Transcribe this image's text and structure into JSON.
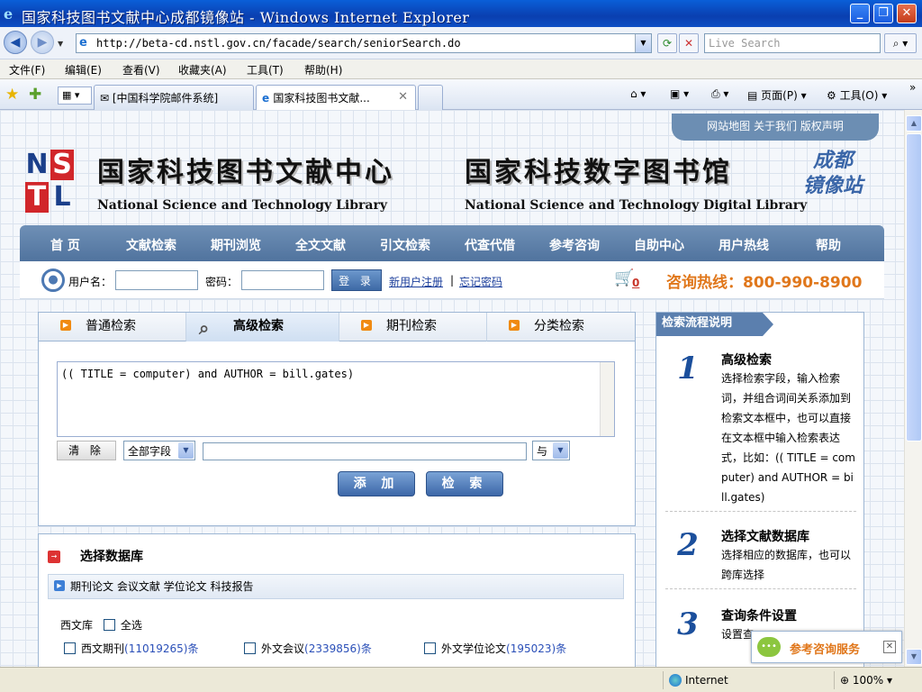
{
  "window": {
    "title": "国家科技图书文献中心成都镜像站 - Windows Internet Explorer",
    "min": "_",
    "max": "❐",
    "close": "✕"
  },
  "address": {
    "url": "http://beta-cd.nstl.gov.cn/facade/search/seniorSearch.do",
    "search_placeholder": "Live Search"
  },
  "menu": [
    "文件(F)",
    "编辑(E)",
    "查看(V)",
    "收藏夹(A)",
    "工具(T)",
    "帮助(H)"
  ],
  "tabs": {
    "items": [
      "[中国科学院邮件系统]",
      "国家科技图书文献..."
    ],
    "commands": [
      "页面(P)",
      "工具(O)"
    ]
  },
  "site": {
    "top_links": "网站地图 关于我们 版权声明",
    "logo_letters": [
      "N",
      "S",
      "T",
      "L"
    ],
    "title_cn_1": "国家科技图书文献中心",
    "title_cn_2": "国家科技数字图书馆",
    "title_en_1": "National Science and Technology Library",
    "title_en_2": "National Science and Technology Digital Library",
    "mirror_label_1": "成都",
    "mirror_label_2": "镜像站",
    "nav": [
      "首 页",
      "文献检索",
      "期刊浏览",
      "全文文献",
      "引文检索",
      "代查代借",
      "参考咨询",
      "自助中心",
      "用户热线",
      "帮助"
    ]
  },
  "login": {
    "username_label": "用户名：",
    "password_label": "密码：",
    "login_button": "登 录",
    "register_link": "新用户注册",
    "separator": "|",
    "forgot_link": "忘记密码",
    "cart_count": "0",
    "hotline": "咨询热线：800-990-8900"
  },
  "search": {
    "tabs": [
      "普通检索",
      "高级检索",
      "期刊检索",
      "分类检索"
    ],
    "active_tab": "高级检索",
    "query_text": "(( TITLE = computer) and AUTHOR = bill.gates)",
    "clear_button": "清 除",
    "field_select": "全部字段",
    "operator_select": "与",
    "add_button": "添 加",
    "search_button": "检 索"
  },
  "database": {
    "title": "选择数据库",
    "categories": "期刊论文 会议文献 学位论文 科技报告",
    "western_label": "西文库",
    "select_all": "全选",
    "items": [
      {
        "name": "西文期刊",
        "count": "(11019265)",
        "unit": "条"
      },
      {
        "name": "外文会议",
        "count": "(2339856)",
        "unit": "条"
      },
      {
        "name": "外文学位论文",
        "count": "(195023)",
        "unit": "条"
      }
    ]
  },
  "flow": {
    "header": "检索流程说明",
    "steps": [
      {
        "num": "1",
        "title": "高级检索",
        "desc": "选择检索字段，输入检索词，并组合词间关系添加到检索文本框中，也可以直接在文本框中输入检索表达式，比如：(( TITLE = computer) and AUTHOR = bill.gates)"
      },
      {
        "num": "2",
        "title": "选择文献数据库",
        "desc": "选择相应的数据库，也可以跨库选择"
      },
      {
        "num": "3",
        "title": "查询条件设置",
        "desc": "设置查"
      }
    ]
  },
  "consult": {
    "label": "参考咨询服务",
    "close": "✕"
  },
  "status": {
    "zone": "Internet",
    "zoom": "100%"
  }
}
